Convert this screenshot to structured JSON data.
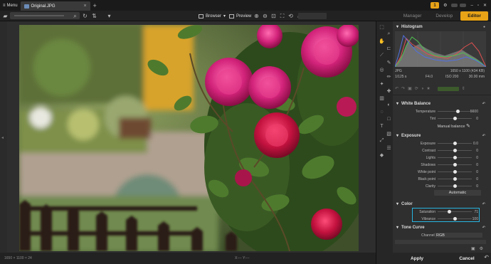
{
  "titlebar": {
    "menu_label": "Menu",
    "tab_label": "Original.JPG",
    "tab_close": "×",
    "new_tab": "+",
    "notification_count": "1"
  },
  "toolbar": {
    "browser_label": "Browser",
    "preview_label": "Preview"
  },
  "modes": [
    "Manager",
    "Develop",
    "Editor"
  ],
  "status": {
    "dimensions": "1650 × 1100 × 24",
    "coords": "X:--- Y:---"
  },
  "panel": {
    "histogram": {
      "title": "Histogram",
      "format": "JPG",
      "dims": "1650 x 1100 (434 KB)",
      "shutter": "1/125 s",
      "aperture": "F4.0",
      "iso": "ISO 200",
      "focal": "30.00 mm"
    },
    "white_balance": {
      "title": "White Balance",
      "rows": [
        {
          "label": "Temperature",
          "value": "5600",
          "pos": 0.6
        },
        {
          "label": "Tint",
          "value": "0",
          "pos": 0.5
        }
      ],
      "manual_label": "Manual balance"
    },
    "exposure": {
      "title": "Exposure",
      "rows": [
        {
          "label": "Exposure",
          "value": "0.0",
          "pos": 0.5
        },
        {
          "label": "Contrast",
          "value": "0",
          "pos": 0.5
        },
        {
          "label": "Lights",
          "value": "0",
          "pos": 0.5
        },
        {
          "label": "Shadows",
          "value": "0",
          "pos": 0.5
        },
        {
          "label": "White point",
          "value": "0",
          "pos": 0.5
        },
        {
          "label": "Black point",
          "value": "0",
          "pos": 0.5
        },
        {
          "label": "Clarity",
          "value": "0",
          "pos": 0.5
        }
      ],
      "auto_label": "Automatic"
    },
    "color": {
      "title": "Color",
      "rows": [
        {
          "label": "Saturation",
          "value": "71",
          "pos": 0.35
        },
        {
          "label": "Vibrance",
          "value": "100",
          "pos": 0.5
        }
      ]
    },
    "tone_curve": {
      "title": "Tone Curve",
      "channel_label": "Channel:",
      "channel_value": "RGB"
    }
  },
  "bottom": {
    "apply": "Apply",
    "cancel": "Cancel"
  },
  "colors": {
    "accent": "#e8a317",
    "highlight": "#27b5e0"
  }
}
